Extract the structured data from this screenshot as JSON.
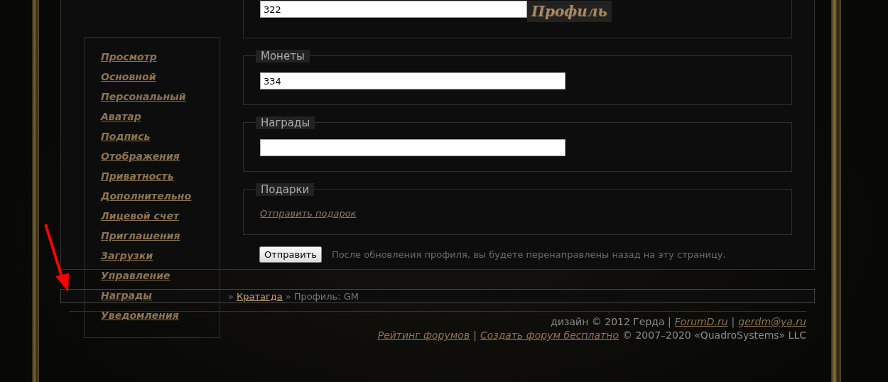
{
  "sidebar": {
    "items": [
      {
        "label": "Просмотр"
      },
      {
        "label": "Основной"
      },
      {
        "label": "Персональный"
      },
      {
        "label": "Аватар"
      },
      {
        "label": "Подпись"
      },
      {
        "label": "Отображения"
      },
      {
        "label": "Приватность"
      },
      {
        "label": "Дополнительно"
      },
      {
        "label": "Лицевой счет"
      },
      {
        "label": "Приглашения"
      },
      {
        "label": "Загрузки"
      },
      {
        "label": "Управление"
      },
      {
        "label": "Награды"
      },
      {
        "label": "Уведомления"
      }
    ]
  },
  "form": {
    "top_field": {
      "value": "322",
      "badge": "Профиль"
    },
    "fieldsets": [
      {
        "legend": "Монеты",
        "kind": "input",
        "value": "334"
      },
      {
        "legend": "Награды",
        "kind": "input"
      },
      {
        "legend": "Подарки",
        "kind": "link",
        "link": "Отправить подарок"
      }
    ],
    "submit": "Отправить",
    "note": "После обновления профиля, вы будете перенаправлены назад на эту страницу."
  },
  "breadcrumb": {
    "separator": "»",
    "link": "Кратагда",
    "current": "Профиль: GM"
  },
  "footer": {
    "line1": [
      {
        "kind": "text",
        "text": "дизайн © 2012 Герда |"
      },
      {
        "kind": "link",
        "text": "ForumD.ru"
      },
      {
        "kind": "text",
        "text": "|"
      },
      {
        "kind": "link",
        "text": "gerdm@ya.ru"
      }
    ],
    "line2": [
      {
        "kind": "link",
        "text": "Рейтинг форумов"
      },
      {
        "kind": "text",
        "text": "|"
      },
      {
        "kind": "link",
        "text": "Создать форум бесплатно"
      },
      {
        "kind": "text",
        "text": "© 2007–2020 «QuadroSystems» LLC"
      }
    ]
  }
}
